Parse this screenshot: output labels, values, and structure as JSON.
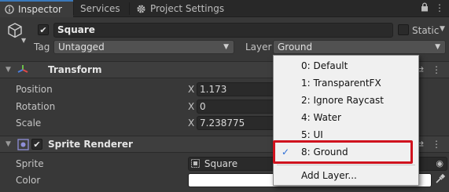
{
  "tabs": [
    {
      "label": "Inspector",
      "icon": "inspector-icon",
      "active": true
    },
    {
      "label": "Services",
      "icon": null,
      "active": false
    },
    {
      "label": "Project Settings",
      "icon": "gear-icon",
      "active": false
    }
  ],
  "header": {
    "object_name": "Square",
    "active_checked": true,
    "static_label": "Static",
    "static_checked": false,
    "tag_label": "Tag",
    "tag_value": "Untagged",
    "layer_label": "Layer",
    "layer_value": "Ground"
  },
  "transform": {
    "title": "Transform",
    "rows": [
      {
        "label": "Position",
        "axis": "X",
        "value": "1.173"
      },
      {
        "label": "Rotation",
        "axis": "X",
        "value": "0"
      },
      {
        "label": "Scale",
        "axis": "X",
        "value": "7.238775"
      }
    ]
  },
  "sprite_renderer": {
    "title": "Sprite Renderer",
    "enabled": true,
    "sprite_label": "Sprite",
    "sprite_value": "Square",
    "color_label": "Color",
    "color_value": "#ffffff"
  },
  "layer_menu": {
    "items": [
      {
        "label": "0: Default",
        "checked": false
      },
      {
        "label": "1: TransparentFX",
        "checked": false
      },
      {
        "label": "2: Ignore Raycast",
        "checked": false
      },
      {
        "label": "4: Water",
        "checked": false
      },
      {
        "label": "5: UI",
        "checked": false
      },
      {
        "label": "8: Ground",
        "checked": true
      }
    ],
    "add_layer_label": "Add Layer...",
    "highlight_color": "#d0121e"
  },
  "colors": {
    "background": "#383838",
    "tab_accent": "#3a79bb",
    "menu_background": "#f0f0f0",
    "check_color": "#2e6fd6"
  }
}
